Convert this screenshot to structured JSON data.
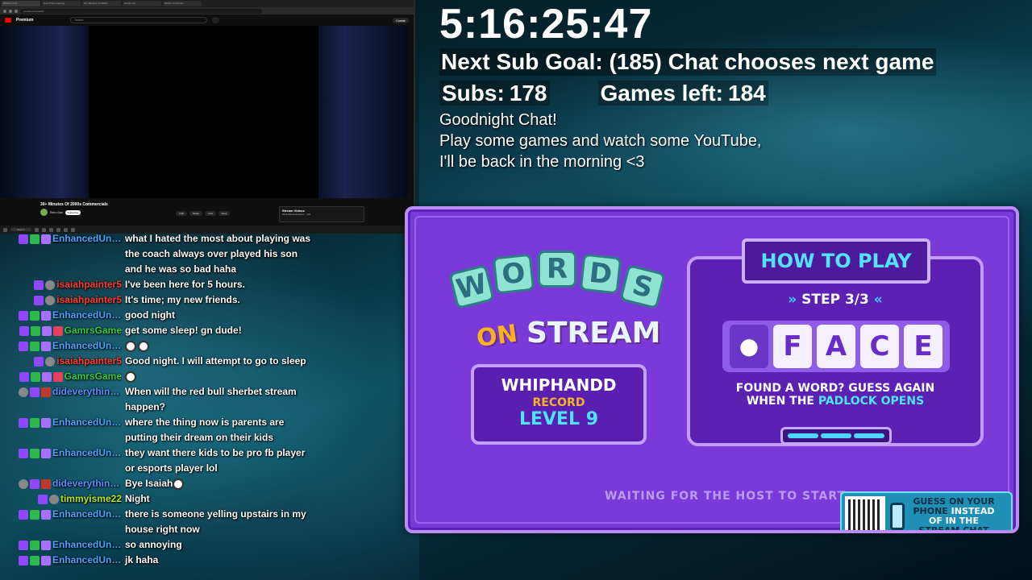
{
  "browser": {
    "tabs": [
      "Wizard of Oz",
      "How Prime Gaming",
      "30+ Minutes Of 2000s",
      "stream bot",
      "Words On Stream"
    ],
    "url": "youtube.com/watch",
    "yt_brand": "Premium",
    "search_placeholder": "Search",
    "create_label": "Create",
    "video_title": "30+ Minutes Of 2000s Commercials",
    "channel_name": "Retro Dan",
    "subscribe_label": "Subscribe",
    "actions": [
      "9.9K",
      "Share",
      "Add",
      "Save"
    ],
    "side_panel_title": "Stream Videos",
    "side_panel_sub": "03 EnhancedUnicorn - 1/8",
    "taskbar_search": "Search"
  },
  "overlay": {
    "timer": "5:16:25:47",
    "goal": "Next Sub Goal: (185) Chat chooses next game",
    "subs_label": "Subs:",
    "subs_value": "178",
    "games_label": "Games left:",
    "games_value": "184",
    "note_line1": "Goodnight Chat!",
    "note_line2": "Play some games and watch some YouTube,",
    "note_line3": "I'll be back in the morning <3"
  },
  "chat": [
    {
      "user": "EnhancedUni...",
      "color": "#4aa3ff",
      "badges": [
        "purple",
        "green",
        "prime"
      ],
      "text": "what I hated the most about playing was the coach always over played his son and he was so bad haha"
    },
    {
      "user": "isaiahpainter5",
      "color": "#ff3b30",
      "badges": [
        "purple",
        "gray"
      ],
      "text": "I've been here for 5 hours."
    },
    {
      "user": "isaiahpainter5",
      "color": "#ff3b30",
      "badges": [
        "purple",
        "gray"
      ],
      "text": "It's time; my new friends."
    },
    {
      "user": "EnhancedUni...",
      "color": "#4aa3ff",
      "badges": [
        "purple",
        "green",
        "prime"
      ],
      "text": "good night"
    },
    {
      "user": "GamrsGame",
      "color": "#2ecc40",
      "badges": [
        "purple",
        "green",
        "prime",
        "gift"
      ],
      "text": "get some sleep! gn dude!"
    },
    {
      "user": "EnhancedUni...",
      "color": "#4aa3ff",
      "badges": [
        "purple",
        "green",
        "prime"
      ],
      "text": "",
      "emotes": 2
    },
    {
      "user": "isaiahpainter5",
      "color": "#ff3b30",
      "badges": [
        "purple",
        "gray"
      ],
      "text": "Good night. I will attempt to go to sleep"
    },
    {
      "user": "GamrsGame",
      "color": "#2ecc40",
      "badges": [
        "purple",
        "green",
        "prime",
        "gift"
      ],
      "text": "",
      "emotes": 1
    },
    {
      "user": "dideverythingla...",
      "color": "#5b8dff",
      "badges": [
        "gray",
        "purple",
        "red"
      ],
      "text": "When will the red bull sherbet stream happen?"
    },
    {
      "user": "EnhancedUni...",
      "color": "#4aa3ff",
      "badges": [
        "purple",
        "green",
        "prime"
      ],
      "text": "where the thing now is parents are putting their dream on their kids"
    },
    {
      "user": "EnhancedUni...",
      "color": "#4aa3ff",
      "badges": [
        "purple",
        "green",
        "prime"
      ],
      "text": "they want there kids to be pro fb player or esports player lol"
    },
    {
      "user": "dideverythingla...",
      "color": "#5b8dff",
      "badges": [
        "gray",
        "purple",
        "red"
      ],
      "text": "Bye Isaiah",
      "emotes": 1
    },
    {
      "user": "timmyisme22",
      "color": "#b5e61d",
      "badges": [
        "purple",
        "gray"
      ],
      "text": "Night"
    },
    {
      "user": "EnhancedUni...",
      "color": "#4aa3ff",
      "badges": [
        "purple",
        "green",
        "prime"
      ],
      "text": "there is someone yelling upstairs in my house right now"
    },
    {
      "user": "EnhancedUni...",
      "color": "#4aa3ff",
      "badges": [
        "purple",
        "green",
        "prime"
      ],
      "text": "so annoying"
    },
    {
      "user": "EnhancedUni...",
      "color": "#4aa3ff",
      "badges": [
        "purple",
        "green",
        "prime"
      ],
      "text": "jk haha"
    }
  ],
  "game": {
    "logo_letters": [
      "W",
      "O",
      "R",
      "D",
      "S"
    ],
    "logo_on": "ON",
    "logo_stream": "STREAM",
    "record_name": "WHIPHANDD",
    "record_label": "RECORD",
    "record_level": "LEVEL 9",
    "howto_title": "HOW TO PLAY",
    "step_label": "STEP 3/3",
    "tiles": [
      "F",
      "A",
      "C",
      "E"
    ],
    "found_line1": "FOUND A WORD? GUESS AGAIN",
    "found_line2_pre": "WHEN THE",
    "found_line2_hl": "PADLOCK OPENS",
    "waiting": "WAITING FOR THE HOST TO START",
    "qr_line1": "GUESS ON YOUR",
    "qr_line2": "PHONE",
    "qr_line2_b": "INSTEAD",
    "qr_line3": "OF IN THE",
    "qr_line4": "STREAM CHAT",
    "progress_steps_done": 3,
    "progress_steps_total": 3
  }
}
